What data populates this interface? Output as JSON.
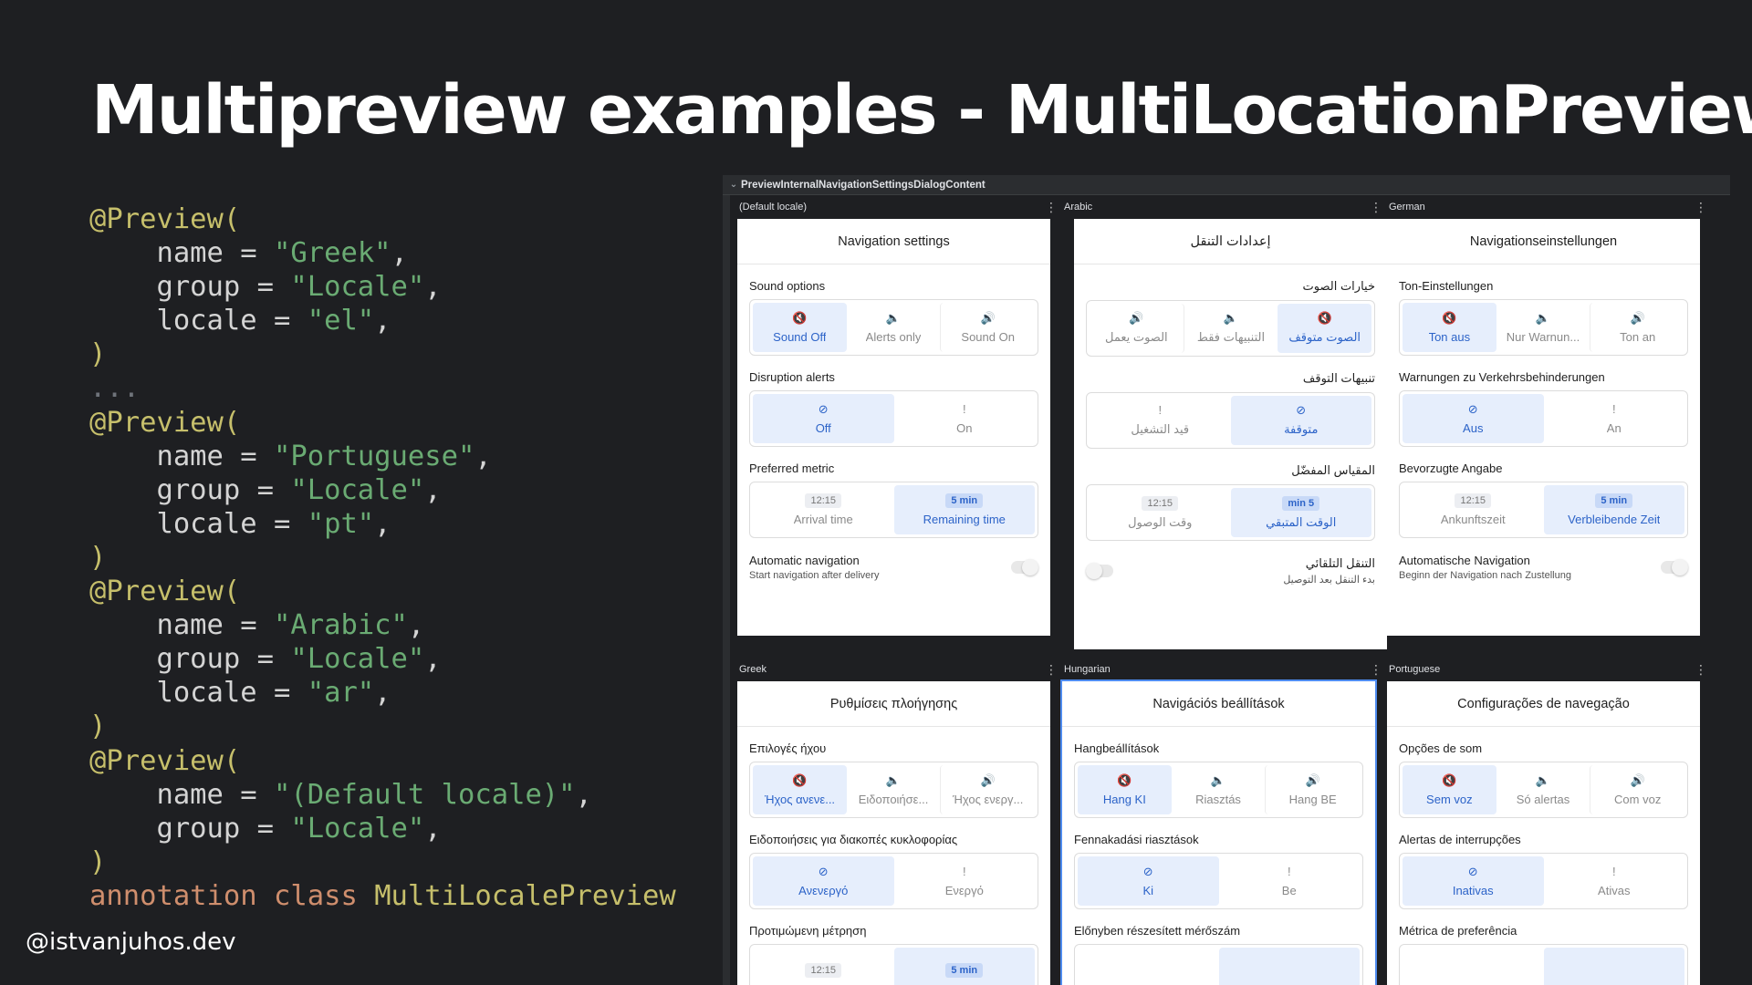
{
  "slide": {
    "title": "Multipreview examples - MultiLocationPreview",
    "handle": "@istvanjuhos.dev"
  },
  "code": {
    "l1": "@Preview(",
    "l2k": "    name = ",
    "l2v": "\"Greek\"",
    "l2e": ",",
    "l3k": "    group = ",
    "l3v": "\"Locale\"",
    "l3e": ",",
    "l4k": "    locale = ",
    "l4v": "\"el\"",
    "l4e": ",",
    "l5": ")",
    "l6": "...",
    "l7": "@Preview(",
    "l8k": "    name = ",
    "l8v": "\"Portuguese\"",
    "l8e": ",",
    "l9k": "    group = ",
    "l9v": "\"Locale\"",
    "l9e": ",",
    "l10k": "    locale = ",
    "l10v": "\"pt\"",
    "l10e": ",",
    "l11": ")",
    "l12": "@Preview(",
    "l13k": "    name = ",
    "l13v": "\"Arabic\"",
    "l13e": ",",
    "l14k": "    group = ",
    "l14v": "\"Locale\"",
    "l14e": ",",
    "l15k": "    locale = ",
    "l15v": "\"ar\"",
    "l15e": ",",
    "l16": ")",
    "l17": "@Preview(",
    "l18k": "    name = ",
    "l18v": "\"(Default locale)\"",
    "l18e": ",",
    "l19k": "    group = ",
    "l19v": "\"Locale\"",
    "l19e": ",",
    "l20": ")",
    "l21a": "annotation",
    "l21b": " class ",
    "l21c": "MultiLocalePreview"
  },
  "ide": {
    "header": "PreviewInternalNavigationSettingsDialogContent"
  },
  "panes": {
    "default": {
      "label": "(Default locale)",
      "title": "Navigation settings",
      "sound_label": "Sound options",
      "sound": [
        "Sound Off",
        "Alerts only",
        "Sound On"
      ],
      "disruption_label": "Disruption alerts",
      "disruption": [
        "Off",
        "On"
      ],
      "metric_label": "Preferred metric",
      "metric_chips": [
        "12:15",
        "5 min"
      ],
      "metric": [
        "Arrival time",
        "Remaining time"
      ],
      "auto_title": "Automatic navigation",
      "auto_sub": "Start navigation after delivery"
    },
    "arabic": {
      "label": "Arabic",
      "title": "إعدادات التنقل",
      "sound_label": "خيارات الصوت",
      "sound": [
        "الصوت متوقف",
        "التنبيهات فقط",
        "الصوت يعمل"
      ],
      "disruption_label": "تنبيهات التوقف",
      "disruption": [
        "متوقفة",
        "قيد التشغيل"
      ],
      "metric_label": "المقياس المفضّل",
      "metric_chips": [
        "5 min",
        "12:15"
      ],
      "metric": [
        "الوقت المتبقي",
        "وقت الوصول"
      ],
      "auto_title": "التنقل التلقائي",
      "auto_sub": "بدء التنقل بعد التوصيل"
    },
    "german": {
      "label": "German",
      "title": "Navigationseinstellungen",
      "sound_label": "Ton-Einstellungen",
      "sound": [
        "Ton aus",
        "Nur Warnun...",
        "Ton an"
      ],
      "disruption_label": "Warnungen zu Verkehrsbehinderungen",
      "disruption": [
        "Aus",
        "An"
      ],
      "metric_label": "Bevorzugte Angabe",
      "metric_chips": [
        "12:15",
        "5 min"
      ],
      "metric": [
        "Ankunftszeit",
        "Verbleibende Zeit"
      ],
      "auto_title": "Automatische Navigation",
      "auto_sub": "Beginn der Navigation nach Zustellung"
    },
    "greek": {
      "label": "Greek",
      "title": "Ρυθμίσεις πλοήγησης",
      "sound_label": "Επιλογές ήχου",
      "sound": [
        "Ήχος ανενε...",
        "Ειδοποιήσε...",
        "Ήχος ενεργ..."
      ],
      "disruption_label": "Ειδοποιήσεις για διακοπές κυκλοφορίας",
      "disruption": [
        "Ανενεργό",
        "Ενεργό"
      ],
      "metric_label": "Προτιμώμενη μέτρηση",
      "metric_chips": [
        "12:15",
        "5 min"
      ]
    },
    "hungarian": {
      "label": "Hungarian",
      "title": "Navigációs beállítások",
      "sound_label": "Hangbeállítások",
      "sound": [
        "Hang KI",
        "Riasztás",
        "Hang BE"
      ],
      "disruption_label": "Fennakadási riasztások",
      "disruption": [
        "Ki",
        "Be"
      ],
      "metric_label": "Előnyben részesített mérőszám"
    },
    "portuguese": {
      "label": "Portuguese",
      "title": "Configurações de navegação",
      "sound_label": "Opções de som",
      "sound": [
        "Sem voz",
        "Só alertas",
        "Com voz"
      ],
      "disruption_label": "Alertas de interrupções",
      "disruption": [
        "Inativas",
        "Ativas"
      ],
      "metric_label": "Métrica de preferência"
    }
  },
  "icons": {
    "sound_off": "🔇",
    "alerts": "🔈",
    "sound_on": "🔊",
    "shield_off": "⊘",
    "shield_alert": "!",
    "more": "⋮",
    "chevron": "⌄"
  },
  "colors": {
    "background": "#1e1f22",
    "accent": "#2c63c8",
    "selected_bg": "#e6eefc",
    "annotation": "#c6bf6b",
    "string": "#6aab73",
    "keyword": "#cf8e6d"
  }
}
